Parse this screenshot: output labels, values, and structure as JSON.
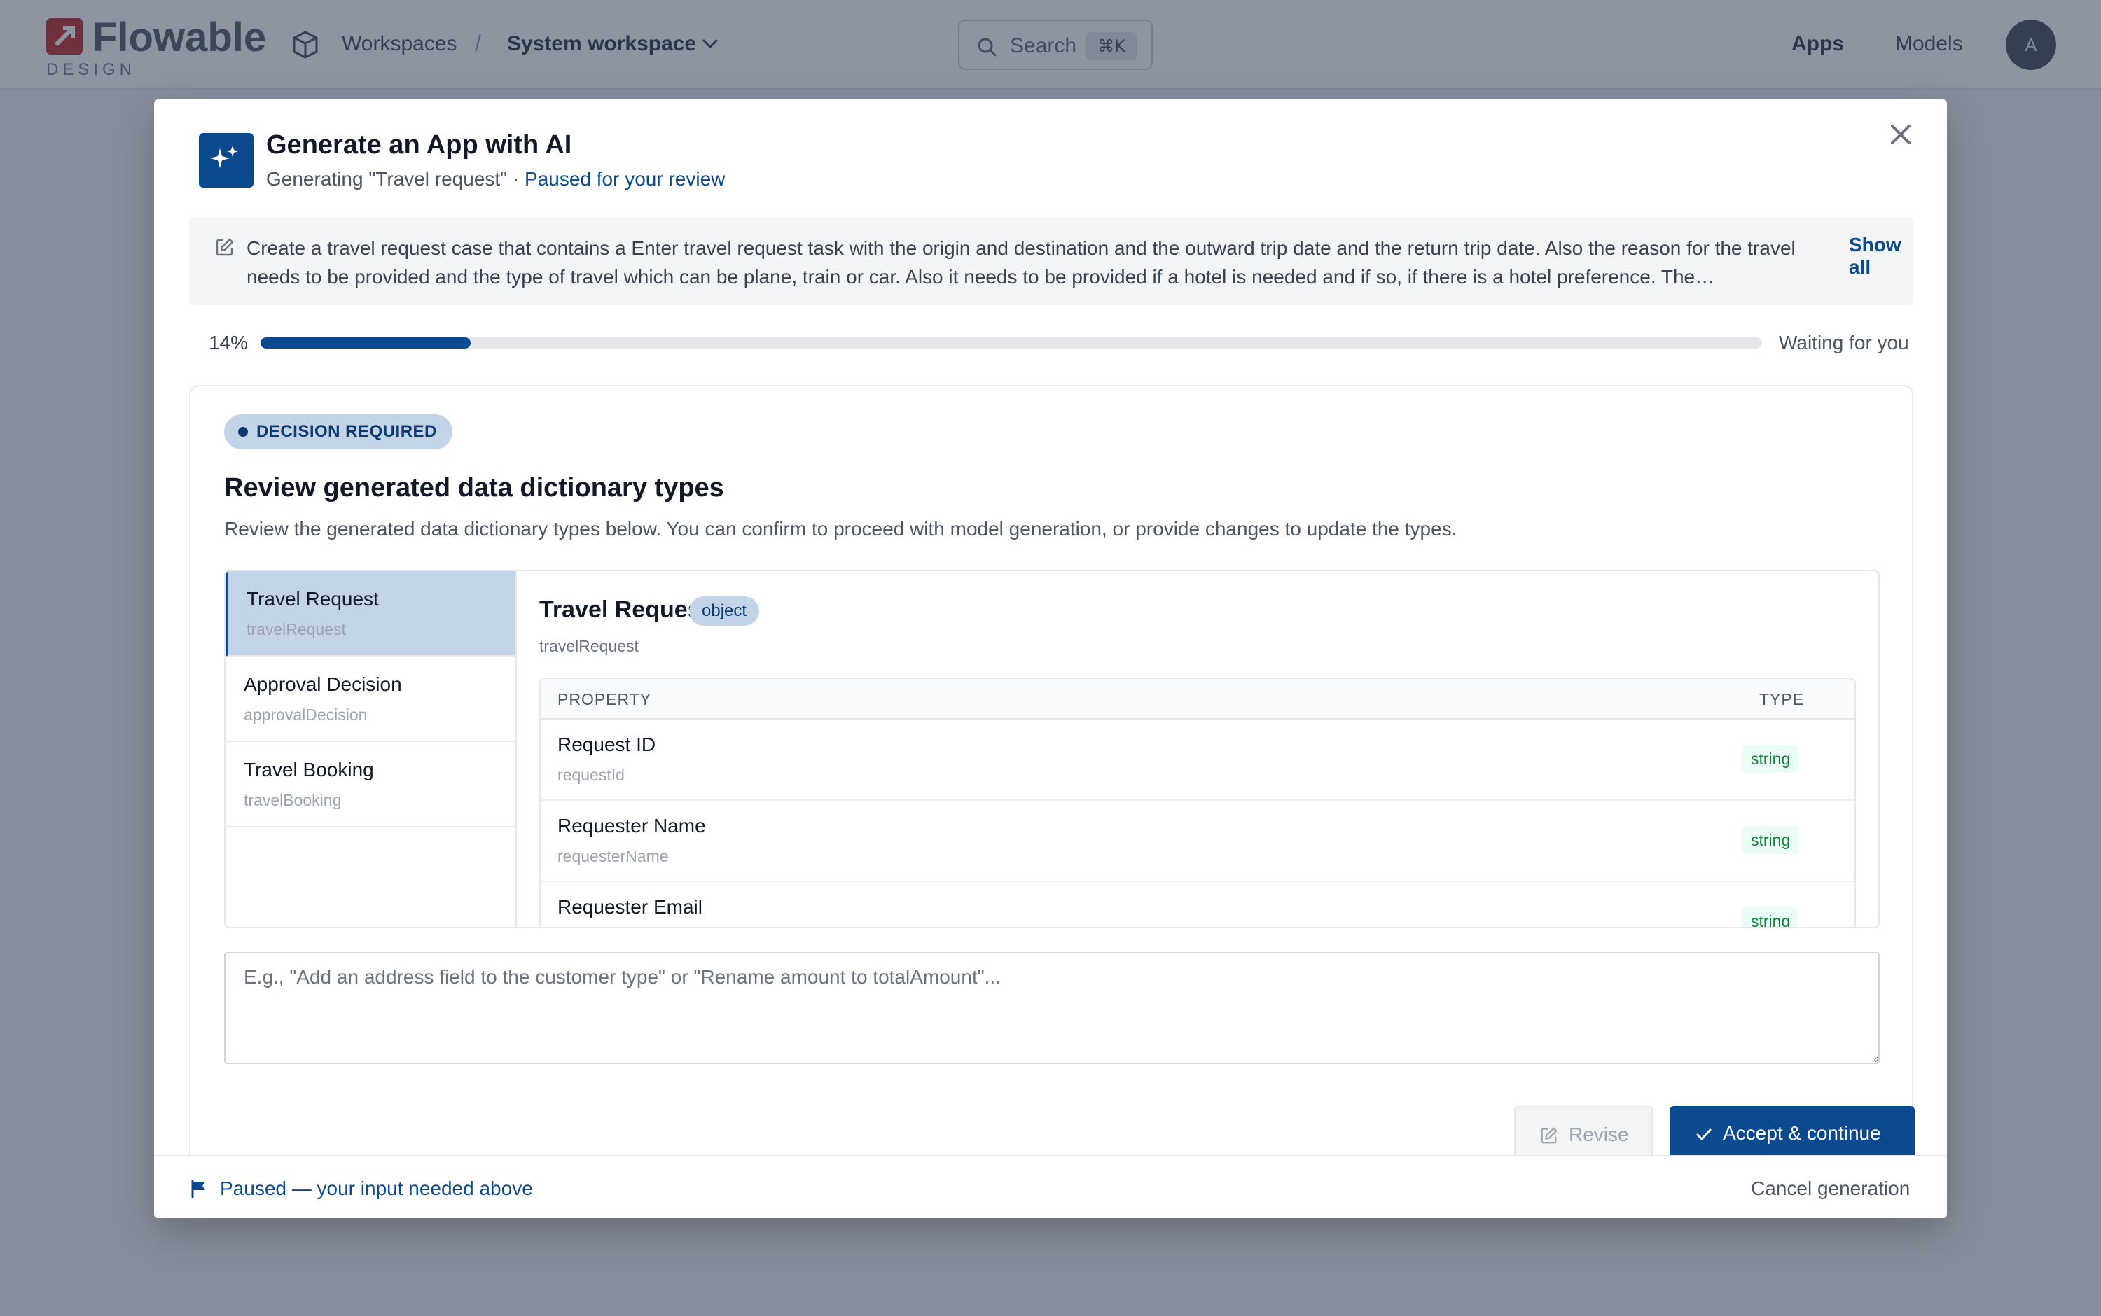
{
  "app": {
    "logo_word": "Flowable",
    "logo_sub": "DESIGN",
    "breadcrumb": {
      "workspaces": "Workspaces",
      "separator": "/",
      "current": "System workspace"
    },
    "search": {
      "placeholder": "Search",
      "shortcut": "⌘K"
    },
    "nav": {
      "apps": "Apps",
      "models": "Models"
    },
    "avatar_initial": "A",
    "icons": {
      "logo": "flowable-logo-icon",
      "workspace": "cube-icon",
      "chevron": "chevron-down-icon",
      "search": "search-icon"
    }
  },
  "modal": {
    "title": "Generate an App with AI",
    "subtitle_prefix": "Generating \"Travel request\"",
    "subtitle_dot": " · ",
    "subtitle_status": "Paused for your review",
    "prompt": {
      "text": "Create a travel request case that contains a Enter travel request task with the origin and destination and the outward trip date and the return trip date. Also the reason for the travel needs to be provided and the type of travel which can be plane, train or car. Also it needs to be provided if a hotel is needed and if so, if there is a hotel preference. The…",
      "show_all": "Show all"
    },
    "progress": {
      "percent_label": "14%",
      "value": 0.14,
      "status": "Waiting for you"
    },
    "review": {
      "badge": "DECISION REQUIRED",
      "title": "Review generated data dictionary types",
      "description": "Review the generated data dictionary types below. You can confirm to proceed with model generation, or provide changes to update the types.",
      "types": [
        {
          "label": "Travel Request",
          "key": "travelRequest"
        },
        {
          "label": "Approval Decision",
          "key": "approvalDecision"
        },
        {
          "label": "Travel Booking",
          "key": "travelBooking"
        }
      ],
      "selected": {
        "label": "Travel Request",
        "kind": "object",
        "key": "travelRequest",
        "columns": {
          "property": "PROPERTY",
          "type": "TYPE"
        },
        "properties": [
          {
            "label": "Request ID",
            "key": "requestId",
            "type": "string"
          },
          {
            "label": "Requester Name",
            "key": "requesterName",
            "type": "string"
          },
          {
            "label": "Requester Email",
            "key": "",
            "type": "string"
          }
        ]
      },
      "revise_placeholder": "E.g., \"Add an address field to the customer type\" or \"Rename amount to totalAmount\"...",
      "revise_value": "",
      "buttons": {
        "revise": "Revise",
        "accept": "Accept & continue"
      }
    },
    "footer": {
      "message": "Paused — your input needed above",
      "cancel": "Cancel generation"
    }
  },
  "colors": {
    "primary": "#0b4a8f",
    "badge_bg": "#c4d4e8",
    "string_type": "#15803d",
    "overlay": "#1e2942"
  }
}
